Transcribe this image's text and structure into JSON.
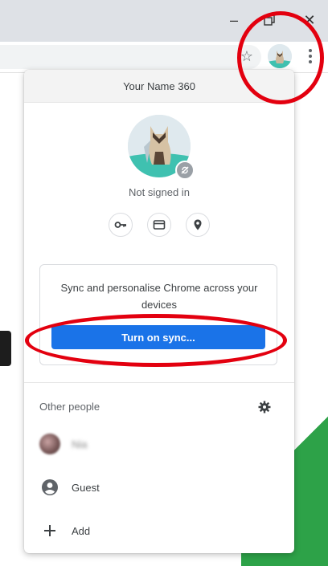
{
  "window": {
    "minimize_label": "–",
    "restore_label": "▭",
    "close_label": "✕"
  },
  "toolbar": {
    "star_label": "☆"
  },
  "panel": {
    "header_name": "Your Name 360",
    "signed_status": "Not signed in",
    "quick_icons": [
      "key-icon",
      "credit-card-icon",
      "location-pin-icon"
    ],
    "sync_description": "Sync and personalise Chrome across your devices",
    "sync_button_label": "Turn on sync...",
    "other_people_title": "Other people",
    "people": [
      {
        "name": "Nia",
        "blurred": true
      },
      {
        "name": "Guest",
        "icon": "account-circle-icon"
      },
      {
        "name": "Add",
        "icon": "plus-icon"
      }
    ]
  },
  "colors": {
    "accent": "#1a73e8",
    "annotation_ring": "#e3000f",
    "titlebar": "#dee1e6",
    "background_green": "#2da248"
  }
}
